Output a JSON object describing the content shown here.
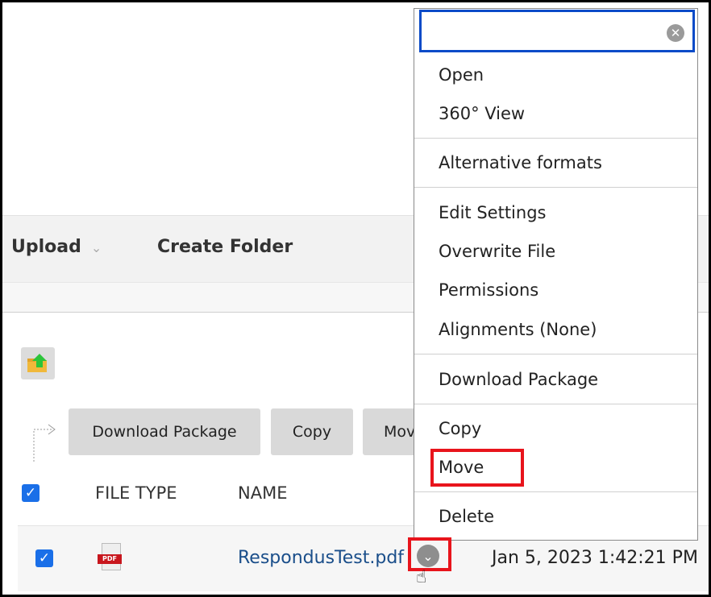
{
  "toolbar": {
    "upload_label": "Upload",
    "create_folder_label": "Create Folder"
  },
  "actions": {
    "download_package": "Download Package",
    "copy": "Copy",
    "move_partial": "Mov"
  },
  "table": {
    "headers": [
      "FILE TYPE",
      "NAME"
    ],
    "rows": [
      {
        "file_type_icon": "pdf-icon",
        "file_type_badge": "PDF",
        "name": "RespondusTest.pdf",
        "date": "Jan 5, 2023 1:42:21 PM",
        "checked": true
      }
    ]
  },
  "menu": {
    "search_value": "",
    "items": [
      "Open",
      "360° View",
      "Alternative formats",
      "Edit Settings",
      "Overwrite File",
      "Permissions",
      "Alignments (None)",
      "Download Package",
      "Copy",
      "Move",
      "Delete"
    ]
  },
  "colors": {
    "highlight": "#e8141c",
    "link": "#1a4e8a",
    "checkbox": "#1a6fe8",
    "focus": "#0a4bc8"
  }
}
